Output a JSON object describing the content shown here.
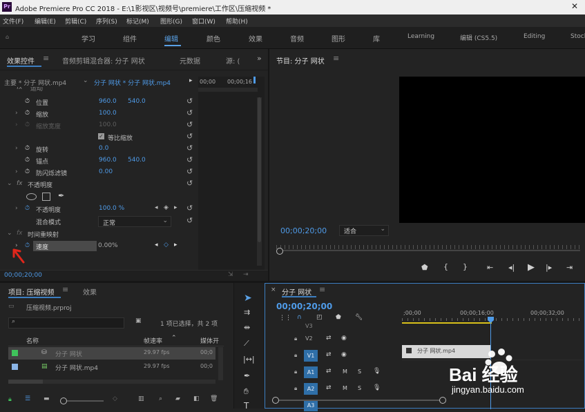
{
  "window": {
    "app_icon": "Pr",
    "title": "Adobe Premiere Pro CC 2018 - E:\\1影视区\\视频号\\premiere\\工作区\\压缩视频 *"
  },
  "menu": [
    "文件(F)",
    "编辑(E)",
    "剪辑(C)",
    "序列(S)",
    "标记(M)",
    "图形(G)",
    "窗口(W)",
    "帮助(H)"
  ],
  "workspaces": [
    "学习",
    "组件",
    "编辑",
    "颜色",
    "效果",
    "音频",
    "图形",
    "库",
    "Learning",
    "编辑 (CS5.5)",
    "Editing",
    "Stock"
  ],
  "active_workspace": "编辑",
  "effect_controls": {
    "tabs": [
      "效果控件",
      "音频剪辑混合器: 分子 网状",
      "元数据",
      "源: ("
    ],
    "clip_source": "主要 * 分子 网状.mp4",
    "clip_target": "分子 网状 * 分子 网状.mp4",
    "timeline_times": [
      "00;00",
      "00;00;16"
    ],
    "cut_label": "运动",
    "props": {
      "position": {
        "label": "位置",
        "x": "960.0",
        "y": "540.0"
      },
      "scale": {
        "label": "缩放",
        "value": "100.0"
      },
      "scale_width": {
        "label": "缩放宽度",
        "value": "100.0"
      },
      "uniform": {
        "label": "等比缩放"
      },
      "rotation": {
        "label": "旋转",
        "value": "0.0"
      },
      "anchor": {
        "label": "锚点",
        "x": "960.0",
        "y": "540.0"
      },
      "antiflicker": {
        "label": "防闪烁滤镜",
        "value": "0.00"
      },
      "opacity_group": {
        "label": "不透明度"
      },
      "opacity": {
        "label": "不透明度",
        "value": "100.0 %"
      },
      "blend": {
        "label": "混合模式",
        "value": "正常"
      },
      "time_remap": {
        "label": "时间重映射"
      },
      "speed": {
        "label": "速度",
        "value": "0.00%"
      }
    },
    "timecode": "00;00;20;00"
  },
  "program": {
    "title": "节目: 分子 网状",
    "timecode": "00;00;20;00",
    "fit": "适合"
  },
  "project": {
    "tabs": [
      "项目: 压缩视频",
      "效果"
    ],
    "file": "压缩视频.prproj",
    "selection": "1 项已选择，共 2 项",
    "columns": [
      "名称",
      "帧速率",
      "媒体开"
    ],
    "items": [
      {
        "name": "分子 网状",
        "fps": "29.97 fps",
        "start": "00;0"
      },
      {
        "name": "分子 网状.mp4",
        "fps": "29.97 fps",
        "start": "00;0"
      }
    ],
    "search_placeholder": ""
  },
  "timeline": {
    "title": "分子 网状",
    "timecode": "00;00;20;00",
    "ruler": [
      ";00;00",
      "00;00;16;00",
      "00;00;32;00"
    ],
    "video_tracks": [
      "V3",
      "V2",
      "V1"
    ],
    "audio_tracks": [
      "A1",
      "A2",
      "A3"
    ],
    "clip": "分子 网状.mp4",
    "track_letters": {
      "mute": "M",
      "solo": "S"
    }
  },
  "watermark": {
    "brand": "Bai 经验",
    "url": "jingyan.baidu.com"
  }
}
